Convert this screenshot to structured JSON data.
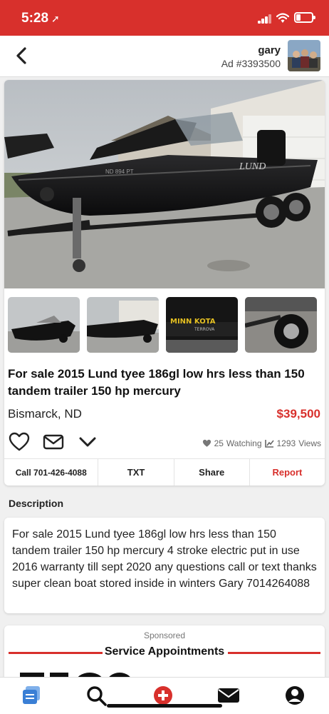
{
  "status": {
    "time": "5:28",
    "location_glyph": "➚"
  },
  "header": {
    "seller_name": "gary",
    "ad_id": "Ad #3393500"
  },
  "listing": {
    "title": "For sale 2015 Lund tyee 186gl low hrs less than 150 tandem trailer 150 hp mercury",
    "location": "Bismarck, ND",
    "price": "$39,500",
    "watching_count": "25",
    "watching_label": "Watching",
    "views_count": "1293",
    "views_label": "Views"
  },
  "buttons": {
    "call": "Call 701-426-4088",
    "txt": "TXT",
    "share": "Share",
    "report": "Report"
  },
  "description": {
    "heading": "Description",
    "text": "For sale 2015 Lund tyee 186gl low hrs less than 150 tandem trailer 150 hp mercury 4 stroke electric put in use 2016 warranty till sept 2020 any questions call or text thanks super clean boat stored inside in winters Gary 7014264088"
  },
  "sponsored": {
    "label": "Sponsored",
    "title": "Service Appointments"
  },
  "images": {
    "hull_lettering": "LUND",
    "registration": "ND 894 PT",
    "motor_brand": "MINN KOTA",
    "motor_model": "TERROVA"
  },
  "icons": [
    "back-arrow-icon",
    "heart-icon",
    "envelope-icon",
    "chevron-down-icon",
    "heart-small-icon",
    "chart-icon",
    "listings-tab-icon",
    "search-tab-icon",
    "post-tab-icon",
    "messages-tab-icon",
    "account-tab-icon"
  ],
  "colors": {
    "brand_red": "#d8302c",
    "tab_blue": "#3a7fd5"
  }
}
